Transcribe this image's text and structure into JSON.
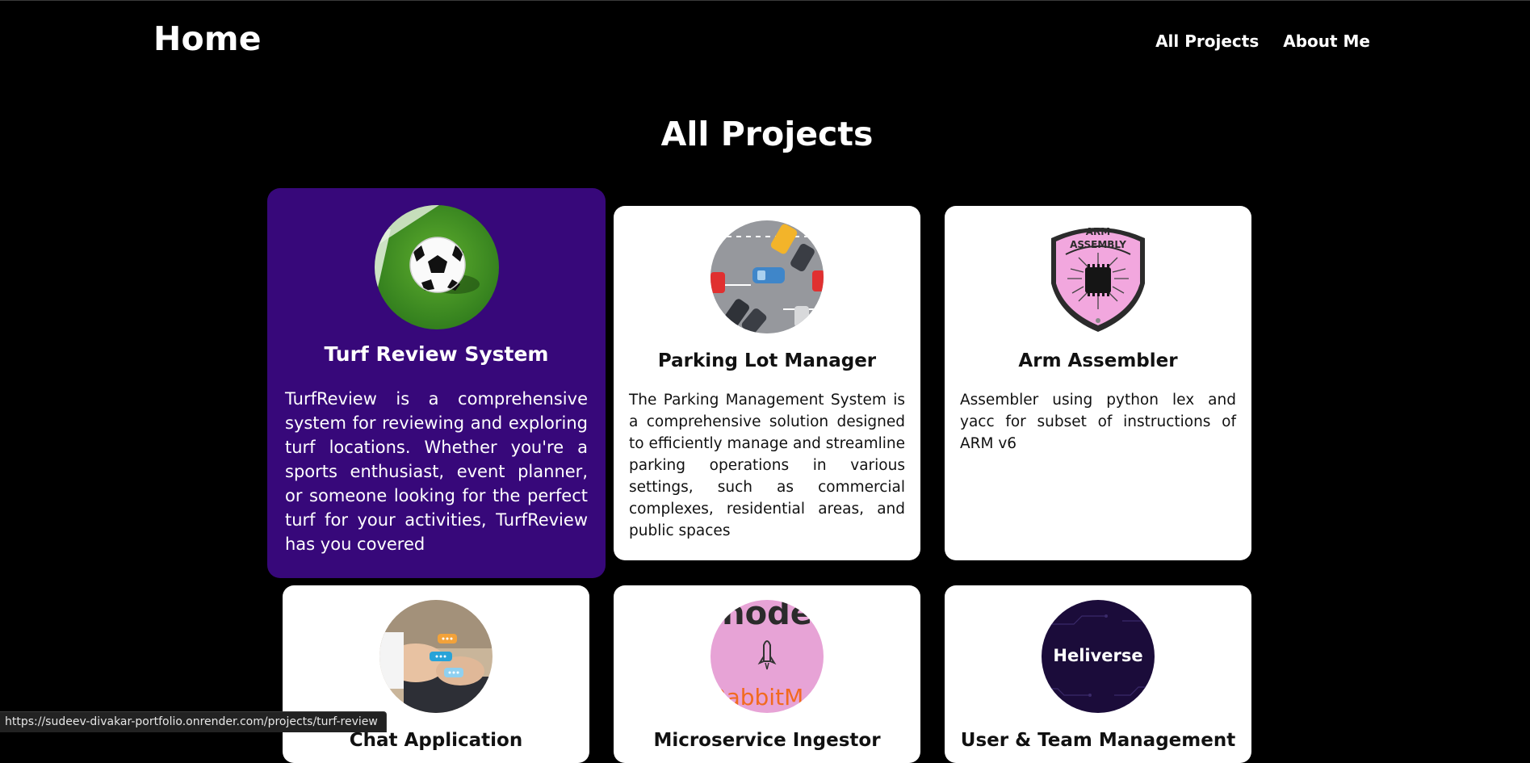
{
  "header": {
    "brand": "Home",
    "nav": [
      {
        "label": "All Projects"
      },
      {
        "label": "About Me"
      }
    ]
  },
  "page_title": "All Projects",
  "projects": [
    {
      "title": "Turf Review System",
      "description": "TurfReview is a comprehensive system for reviewing and exploring turf locations. Whether you're a sports enthusiast, event planner, or someone looking for the perfect turf for your activities, TurfReview has you covered",
      "image": "soccer-ball-on-turf",
      "active": true
    },
    {
      "title": "Parking Lot Manager",
      "description": "The Parking Management System is a comprehensive solution designed to efficiently manage and streamline parking operations in various settings, such as commercial complexes, residential areas, and public spaces",
      "image": "parking-lot-top-view"
    },
    {
      "title": "Arm Assembler",
      "description": "Assembler using python lex and yacc for subset of instructions of ARM v6",
      "image": "arm-assembly-badge",
      "badge_text": [
        "ARM",
        "ASSEMBLY"
      ]
    },
    {
      "title": "Chat Application",
      "description": "",
      "image": "hands-typing-chat-bubbles"
    },
    {
      "title": "Microservice Ingestor",
      "description": "",
      "image": "node-rabbitmq-logo",
      "logo_text_top": "node",
      "logo_text_bottom": "RabbitM"
    },
    {
      "title": "User & Team Management",
      "description": "",
      "image": "heliverse-logo",
      "logo_text": "Heliverse"
    }
  ],
  "status_url": "https://sudeev-divakar-portfolio.onrender.com/projects/turf-review",
  "colors": {
    "background": "#000000",
    "active_card": "#37087a",
    "card": "#ffffff"
  }
}
